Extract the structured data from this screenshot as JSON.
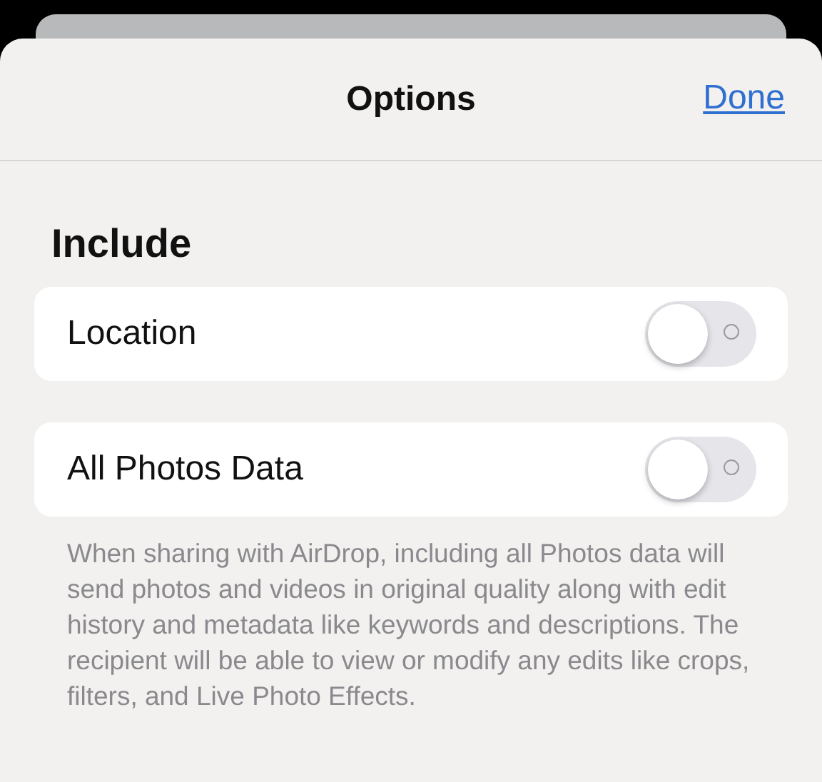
{
  "header": {
    "title": "Options",
    "done": "Done"
  },
  "section": {
    "title": "Include",
    "rows": [
      {
        "label": "Location",
        "on": false
      },
      {
        "label": "All Photos Data",
        "on": false
      }
    ],
    "footer": "When sharing with AirDrop, including all Photos data will send photos and videos in original quality along with edit history and metadata like keywords and descriptions. The recipient will be able to view or modify any edits like crops, filters, and Live Photo Effects."
  }
}
